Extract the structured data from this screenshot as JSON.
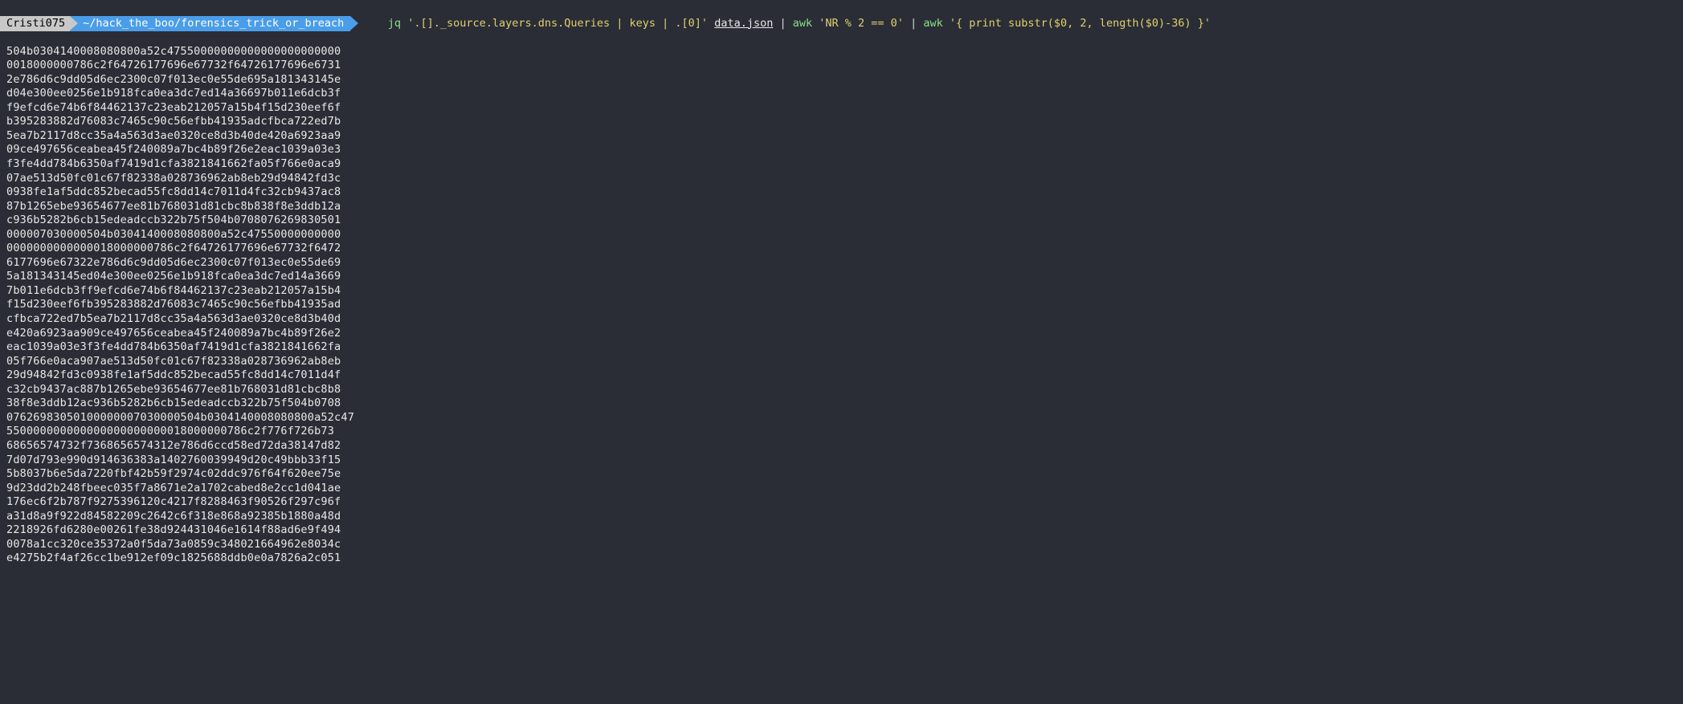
{
  "prompt": {
    "user": "Cristi075",
    "path": "~/hack_the_boo/forensics_trick_or_breach"
  },
  "command": {
    "jq_cmd": "jq",
    "jq_filter": "'.[]._source.layers.dns.Queries | keys | .[0]'",
    "file": "data.json",
    "pipe1": " | ",
    "awk1_cmd": "awk",
    "awk1_arg": "'NR % 2 == 0'",
    "pipe2": " | ",
    "awk2_cmd": "awk",
    "awk2_arg": "'{ print substr($0, 2, length($0)-36) }'"
  },
  "output_lines": [
    "504b0304140008080800a52c47550000000000000000000000",
    "0018000000786c2f64726177696e67732f64726177696e6731",
    "2e786d6c9dd05d6ec2300c07f013ec0e55de695a181343145e",
    "d04e300ee0256e1b918fca0ea3dc7ed14a36697b011e6dcb3f",
    "f9efcd6e74b6f84462137c23eab212057a15b4f15d230eef6f",
    "b395283882d76083c7465c90c56efbb41935adcfbca722ed7b",
    "5ea7b2117d8cc35a4a563d3ae0320ce8d3b40de420a6923aa9",
    "09ce497656ceabea45f240089a7bc4b89f26e2eac1039a03e3",
    "f3fe4dd784b6350af7419d1cfa3821841662fa05f766e0aca9",
    "07ae513d50fc01c67f82338a028736962ab8eb29d94842fd3c",
    "0938fe1af5ddc852becad55fc8dd14c7011d4fc32cb9437ac8",
    "87b1265ebe93654677ee81b768031d81cbc8b838f8e3ddb12a",
    "c936b5282b6cb15edeadccb322b75f504b0708076269830501",
    "000007030000504b0304140008080800a52c47550000000000",
    "0000000000000018000000786c2f64726177696e67732f6472",
    "6177696e67322e786d6c9dd05d6ec2300c07f013ec0e55de69",
    "5a181343145ed04e300ee0256e1b918fca0ea3dc7ed14a3669",
    "7b011e6dcb3ff9efcd6e74b6f84462137c23eab212057a15b4",
    "f15d230eef6fb395283882d76083c7465c90c56efbb41935ad",
    "cfbca722ed7b5ea7b2117d8cc35a4a563d3ae0320ce8d3b40d",
    "e420a6923aa909ce497656ceabea45f240089a7bc4b89f26e2",
    "eac1039a03e3f3fe4dd784b6350af7419d1cfa3821841662fa",
    "05f766e0aca907ae513d50fc01c67f82338a028736962ab8eb",
    "29d94842fd3c0938fe1af5ddc852becad55fc8dd14c7011d4f",
    "c32cb9437ac887b1265ebe93654677ee81b768031d81cbc8b8",
    "38f8e3ddb12ac936b5282b6cb15edeadccb322b75f504b0708",
    "07626983050100000007030000504b0304140008080800a52c47",
    "550000000000000000000000018000000786c2f776f726b73",
    "68656574732f7368656574312e786d6ccd58ed72da38147d82",
    "7d07d793e990d914636383a1402760039949d20c49bbb33f15",
    "5b8037b6e5da7220fbf42b59f2974c02ddc976f64f620ee75e",
    "9d23dd2b248fbeec035f7a8671e2a1702cabed8e2cc1d041ae",
    "176ec6f2b787f9275396120c4217f8288463f90526f297c96f",
    "a31d8a9f922d84582209c2642c6f318e868a92385b1880a48d",
    "2218926fd6280e00261fe38d924431046e1614f88ad6e9f494",
    "0078a1cc320ce35372a0f5da73a0859c348021664962e8034c",
    "e4275b2f4af26cc1be912ef09c1825688ddb0e0a7826a2c051"
  ]
}
